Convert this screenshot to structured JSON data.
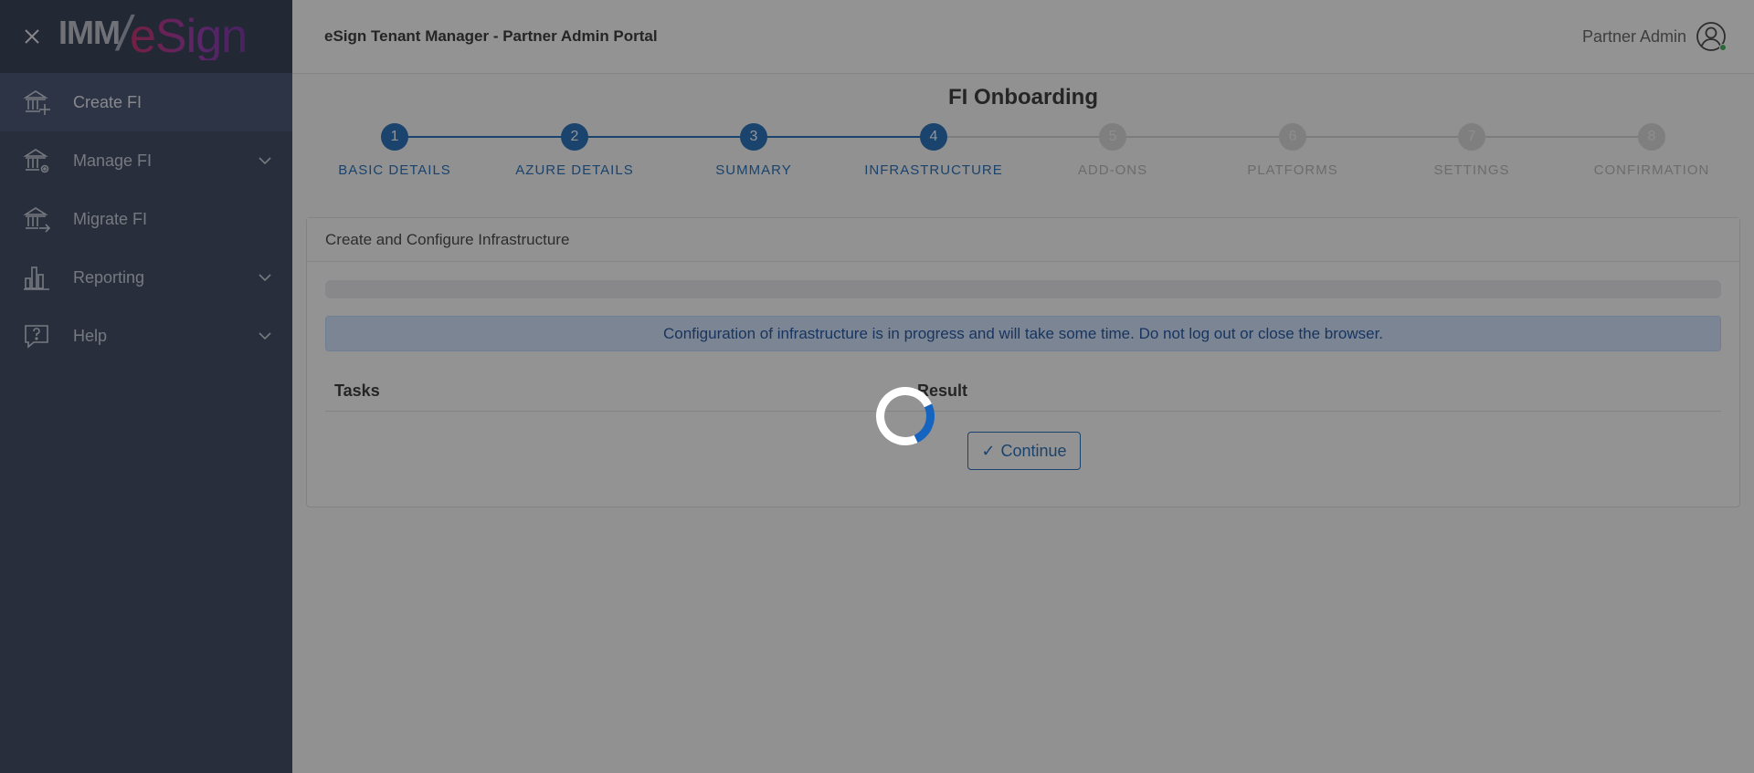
{
  "sidebar": {
    "logo": {
      "prefix": "IMM",
      "slash": "/",
      "brand": "eSign"
    },
    "items": [
      {
        "label": "Create FI",
        "icon": "bank-add-icon",
        "active": true,
        "has_chevron": false
      },
      {
        "label": "Manage FI",
        "icon": "bank-gear-icon",
        "active": false,
        "has_chevron": true
      },
      {
        "label": "Migrate FI",
        "icon": "bank-arrow-icon",
        "active": false,
        "has_chevron": false
      },
      {
        "label": "Reporting",
        "icon": "bar-chart-icon",
        "active": false,
        "has_chevron": true
      },
      {
        "label": "Help",
        "icon": "help-bubble-icon",
        "active": false,
        "has_chevron": true
      }
    ]
  },
  "header": {
    "title": "eSign Tenant Manager - Partner Admin Portal",
    "user_name": "Partner Admin"
  },
  "main": {
    "page_title": "FI Onboarding",
    "steps": [
      {
        "number": "1",
        "label": "BASIC DETAILS",
        "state": "done"
      },
      {
        "number": "2",
        "label": "AZURE DETAILS",
        "state": "done"
      },
      {
        "number": "3",
        "label": "SUMMARY",
        "state": "done"
      },
      {
        "number": "4",
        "label": "INFRASTRUCTURE",
        "state": "done"
      },
      {
        "number": "5",
        "label": "ADD-ONS",
        "state": "todo"
      },
      {
        "number": "6",
        "label": "PLATFORMS",
        "state": "todo"
      },
      {
        "number": "7",
        "label": "SETTINGS",
        "state": "todo"
      },
      {
        "number": "8",
        "label": "CONFIRMATION",
        "state": "todo"
      }
    ],
    "card": {
      "title": "Create and Configure Infrastructure",
      "alert": "Configuration of infrastructure is in progress and will take some time. Do not log out or close the browser.",
      "table_headers": {
        "tasks": "Tasks",
        "result": "Result"
      },
      "continue_label": "Continue"
    }
  },
  "colors": {
    "sidebar_bg": "#2a3550",
    "accent": "#0d5fb3",
    "alert_bg": "#cfe2ff",
    "alert_text": "#084298"
  }
}
